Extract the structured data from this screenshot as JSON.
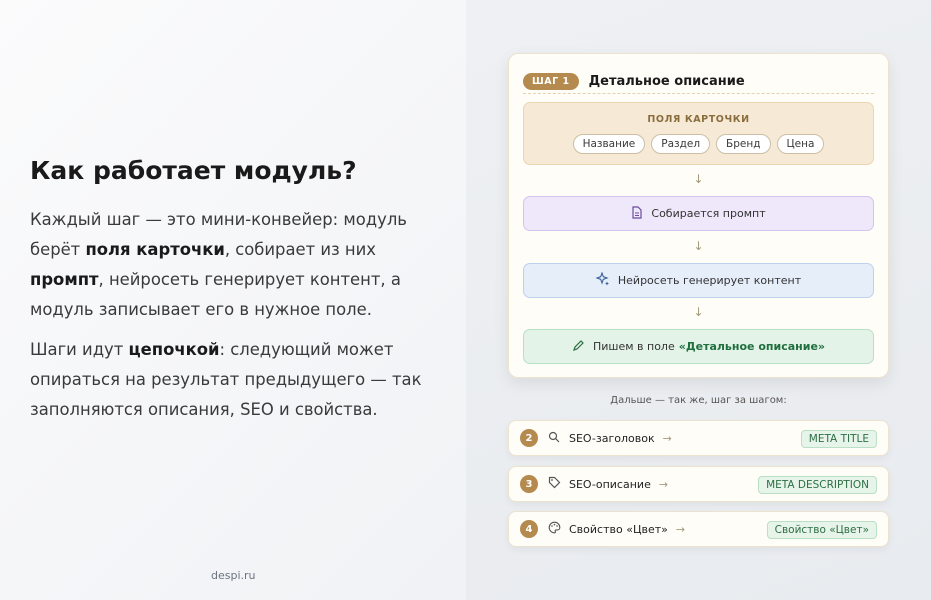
{
  "left": {
    "heading": "Как работает модуль?",
    "p1": {
      "a": "Каждый шаг — это мини-конвейер: модуль берёт ",
      "b": "поля карточки",
      "c": ", собирает из них ",
      "d": "промпт",
      "e": ", нейросеть генерирует контент, а модуль записывает его в нужное поле."
    },
    "p2": {
      "a": "Шаги идут ",
      "b": "цепочкой",
      "c": ": следующий может опираться на результат предыдущего — так заполняются описания, SEO и свойства."
    },
    "brand": "despi.ru"
  },
  "step1": {
    "badge": "ШАГ 1",
    "title": "Детальное описание",
    "fields_title": "ПОЛЯ КАРТОЧКИ",
    "chips": [
      "Название",
      "Раздел",
      "Бренд",
      "Цена"
    ],
    "arrow": "↓",
    "prompt": "Собирается промпт",
    "ai": "Нейросеть генерирует контент",
    "write_prefix": "Пишем в поле",
    "write_field": "«Детальное описание»"
  },
  "next_label": "Дальше — так же, шаг за шагом:",
  "steps": [
    {
      "num": "2",
      "icon": "search-icon",
      "label": "SEO-заголовок",
      "arrow": "→",
      "tag": "META TITLE"
    },
    {
      "num": "3",
      "icon": "tag-icon",
      "label": "SEO-описание",
      "arrow": "→",
      "tag": "META DESCRIPTION"
    },
    {
      "num": "4",
      "icon": "palette-icon",
      "label": "Свойство «Цвет»",
      "arrow": "→",
      "tag": "Свойство «Цвет»"
    }
  ],
  "colors": {
    "accent": "#b48a4e",
    "green": "#2e6e44"
  }
}
